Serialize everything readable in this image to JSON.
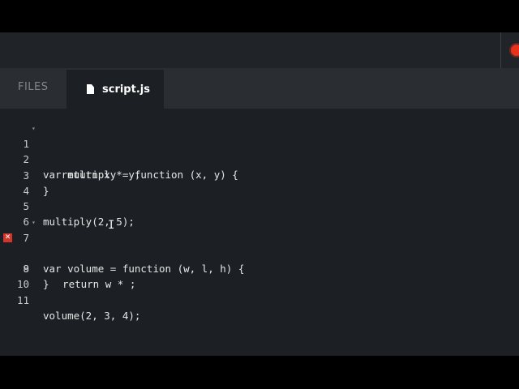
{
  "tabs": {
    "files_label": "FILES",
    "script_label": "script.js"
  },
  "icons": {
    "file": "file-icon",
    "error": "error-icon",
    "fold": "fold-arrow-icon",
    "cursor": "text-cursor-icon",
    "toolbar_badge": "record-icon"
  },
  "colors": {
    "editor_bg": "#1c2024",
    "tabbar_bg": "#2a2e33",
    "toolbar_bg": "#202428",
    "error": "#d2362a",
    "badge": "#e8321c"
  },
  "code": {
    "lines": [
      {
        "number": "1",
        "text": "var multiply = function (x, y) {"
      },
      {
        "number": "2",
        "text": "   return x * y;"
      },
      {
        "number": "3",
        "text": "}"
      },
      {
        "number": "4",
        "text": ""
      },
      {
        "number": "5",
        "text": "multiply(2, 5);"
      },
      {
        "number": "6",
        "text": ""
      },
      {
        "number": "7",
        "text": "var volume = function (w, l, h) {"
      },
      {
        "number": "8",
        "text": "  return w * ;"
      },
      {
        "number": "9",
        "text": "}"
      },
      {
        "number": "10",
        "text": ""
      },
      {
        "number": "11",
        "text": "volume(2, 3, 4);"
      }
    ],
    "error_line": "8",
    "error_symbol": "✕",
    "fold_symbol": "▾"
  }
}
